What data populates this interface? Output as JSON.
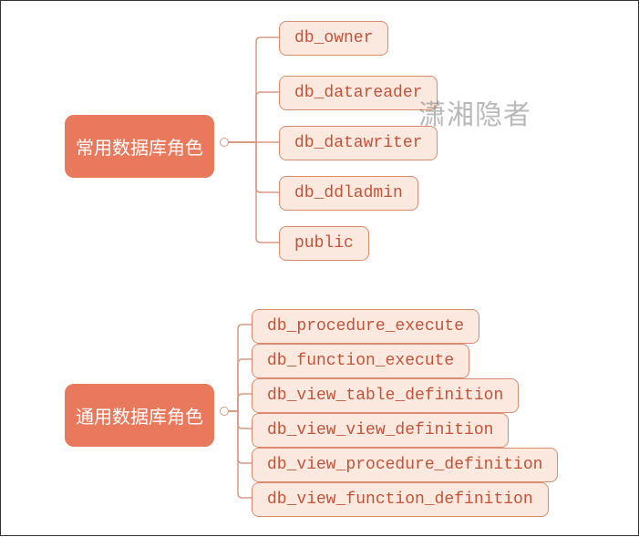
{
  "watermark": "潇湘隐者",
  "groups": [
    {
      "id": "common",
      "label": "常用数据库角色",
      "children": [
        "db_owner",
        "db_datareader",
        "db_datawriter",
        "db_ddladmin",
        "public"
      ]
    },
    {
      "id": "general",
      "label": "通用数据库角色",
      "children": [
        "db_procedure_execute",
        "db_function_execute",
        "db_view_table_definition",
        "db_view_view_definition",
        "db_view_procedure_definition",
        "db_view_function_definition"
      ]
    }
  ]
}
